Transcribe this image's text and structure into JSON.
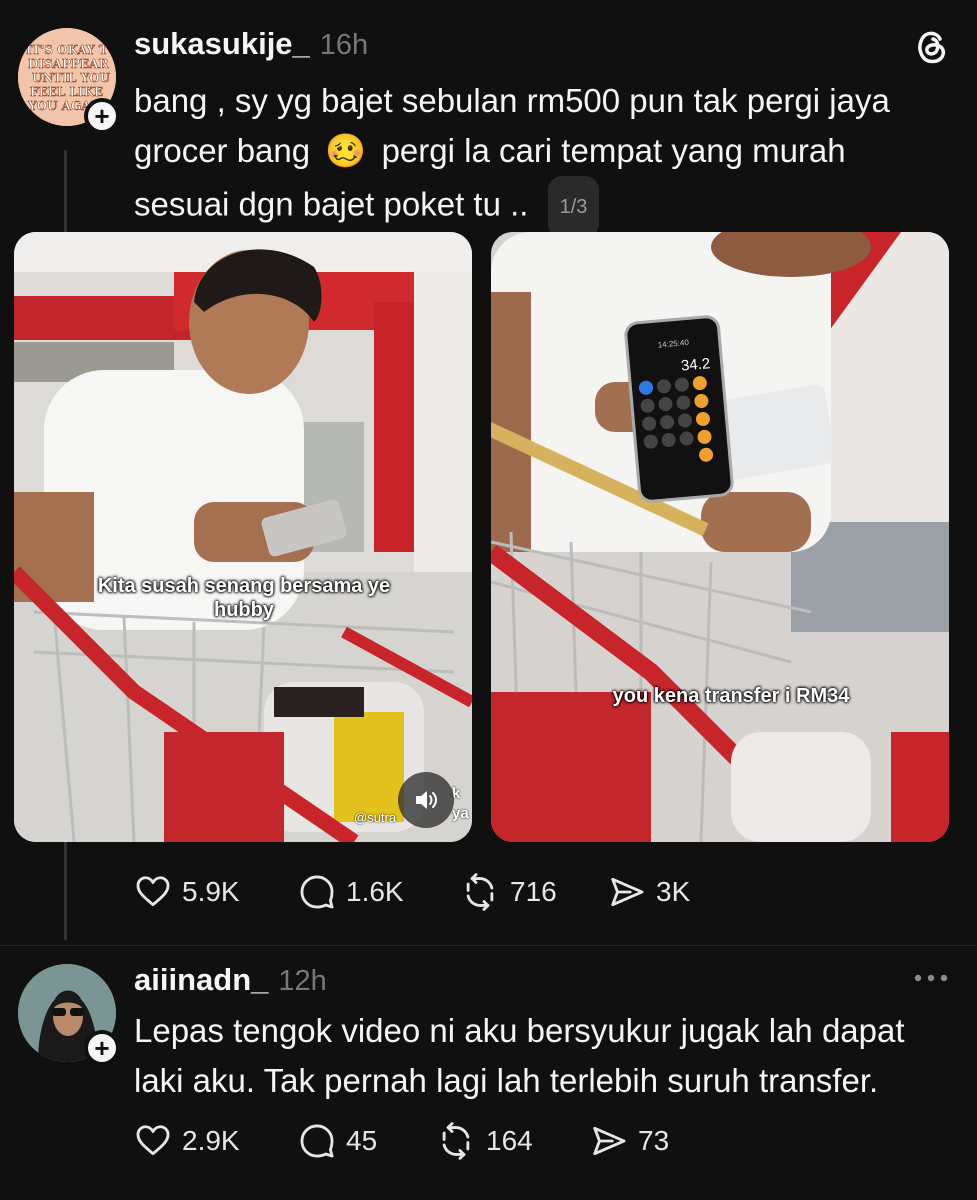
{
  "post": {
    "avatar_text": "IT'S OKAY TO DISAPPEAR UNTIL YOU FEEL LIKE YOU AGAIN",
    "username": "sukasukije_",
    "time": "16h",
    "text_line1": "bang , sy yg bajet sebulan rm500 pun tak pergi jaya",
    "text_line2_before": "grocer bang",
    "emoji": "🥴",
    "text_line2_after": "pergi la cari tempat yang murah",
    "text_line3": "sesuai dgn bajet poket tu ..",
    "page_indicator": "1/3",
    "media": [
      {
        "caption": "Kita susah senang bersama ye hubby",
        "watermark": "@sutra",
        "watermark_right": "k\nya"
      },
      {
        "caption": "you kena transfer i RM34",
        "calc_value": "34.2",
        "calc_time": "14:25:40"
      }
    ],
    "actions": {
      "likes": "5.9K",
      "comments": "1.6K",
      "reposts": "716",
      "shares": "3K"
    }
  },
  "reply": {
    "username": "aiiinadn_",
    "time": "12h",
    "text_line1": "Lepas tengok video ni aku bersyukur jugak lah dapat",
    "text_line2": "laki aku. Tak pernah lagi lah terlebih suruh transfer.",
    "actions": {
      "likes": "2.9K",
      "comments": "45",
      "reposts": "164",
      "shares": "73"
    }
  },
  "colors": {
    "background": "#101010",
    "text": "#f3f5f7",
    "muted": "#777777"
  }
}
